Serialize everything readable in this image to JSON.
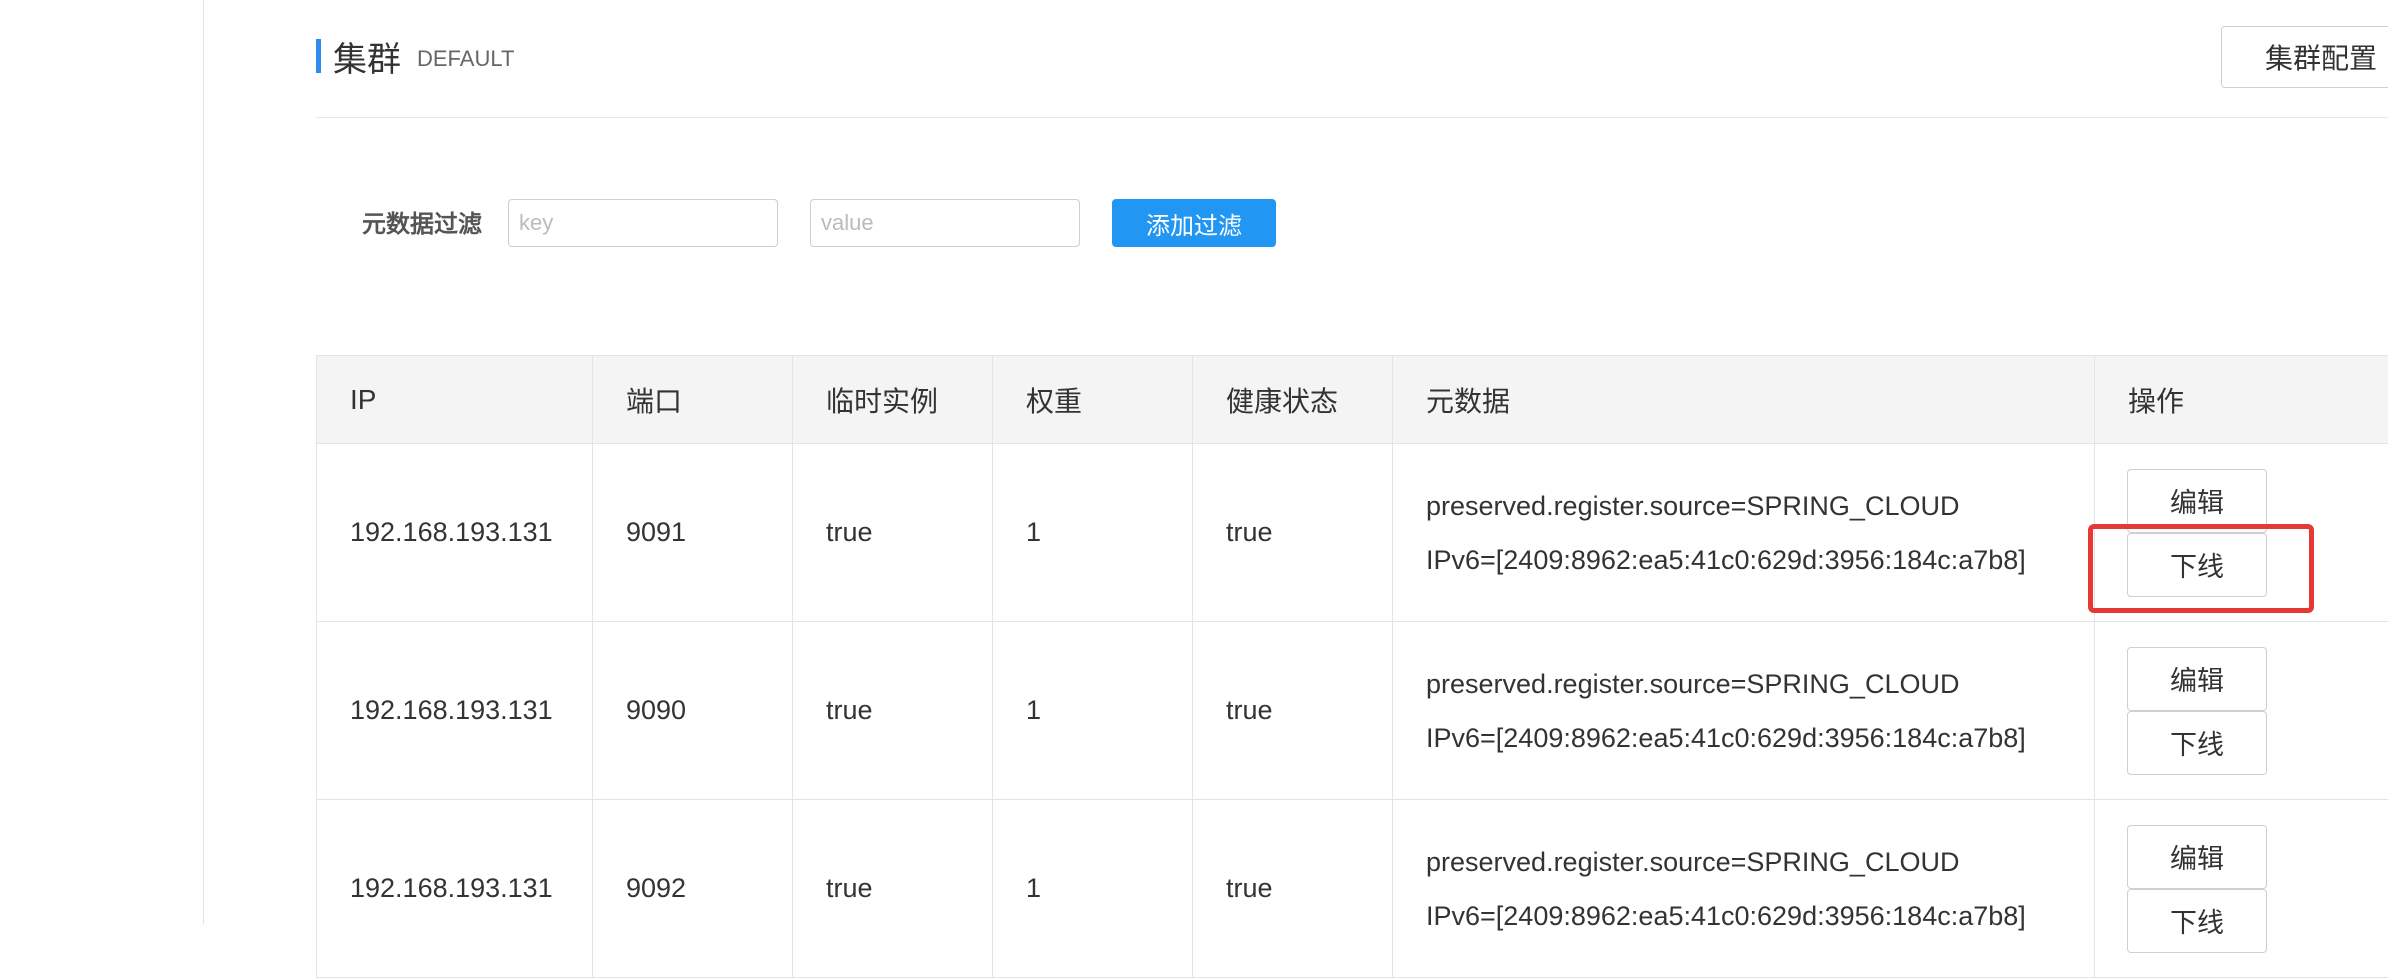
{
  "header": {
    "title": "集群",
    "subtitle": "DEFAULT",
    "config_button": "集群配置"
  },
  "filter": {
    "label": "元数据过滤",
    "key_placeholder": "key",
    "value_placeholder": "value",
    "add_button": "添加过滤"
  },
  "table": {
    "headers": [
      "IP",
      "端口",
      "临时实例",
      "权重",
      "健康状态",
      "元数据",
      "操作"
    ],
    "rows": [
      {
        "ip": "192.168.193.131",
        "port": "9091",
        "ephemeral": "true",
        "weight": "1",
        "healthy": "true",
        "meta1": "preserved.register.source=SPRING_CLOUD",
        "meta2": "IPv6=[2409:8962:ea5:41c0:629d:3956:184c:a7b8]",
        "edit": "编辑",
        "offline": "下线"
      },
      {
        "ip": "192.168.193.131",
        "port": "9090",
        "ephemeral": "true",
        "weight": "1",
        "healthy": "true",
        "meta1": "preserved.register.source=SPRING_CLOUD",
        "meta2": "IPv6=[2409:8962:ea5:41c0:629d:3956:184c:a7b8]",
        "edit": "编辑",
        "offline": "下线"
      },
      {
        "ip": "192.168.193.131",
        "port": "9092",
        "ephemeral": "true",
        "weight": "1",
        "healthy": "true",
        "meta1": "preserved.register.source=SPRING_CLOUD",
        "meta2": "IPv6=[2409:8962:ea5:41c0:629d:3956:184c:a7b8]",
        "edit": "编辑",
        "offline": "下线"
      }
    ]
  },
  "colors": {
    "accent": "#2196f3",
    "highlight": "#e53935",
    "header_bg": "#f4f4f4",
    "border": "#e4e4e4"
  }
}
